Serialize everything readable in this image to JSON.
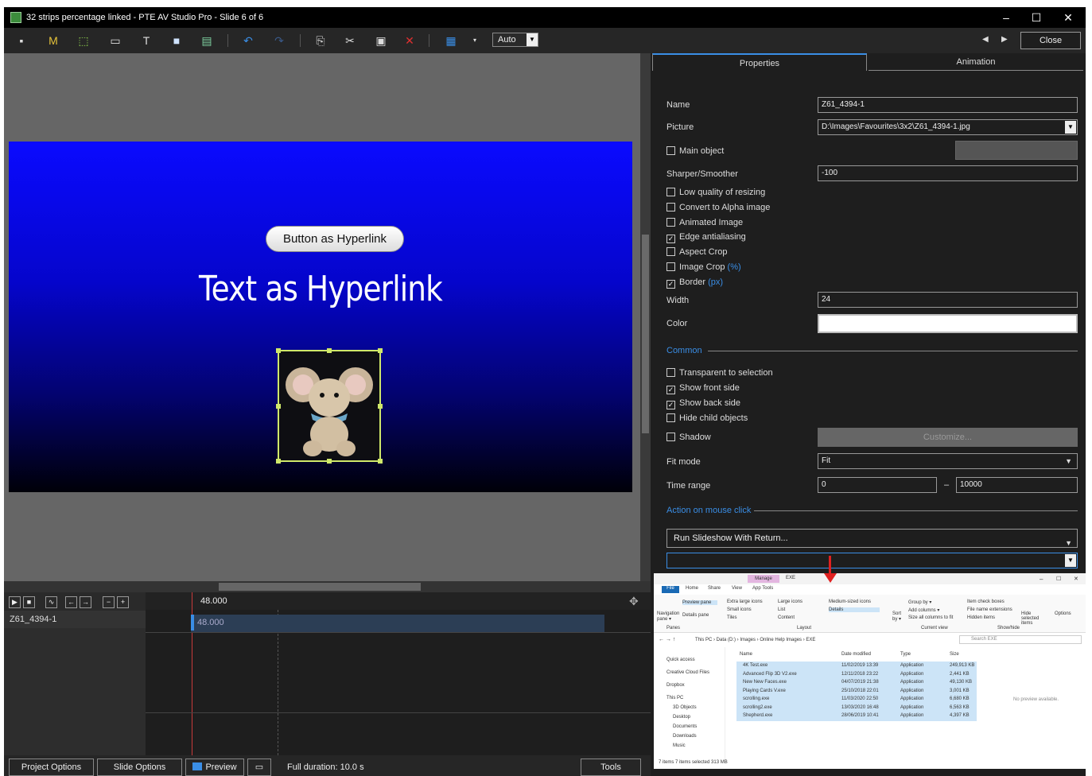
{
  "window": {
    "title": "32 strips percentage linked - PTE AV Studio Pro - Slide 6 of 6"
  },
  "toolbar": {
    "auto_label": "Auto",
    "close_label": "Close",
    "icons": [
      "camera-icon",
      "mask-icon",
      "frame-icon",
      "button-icon",
      "text-icon",
      "rectangle-icon",
      "image-icon",
      "undo-icon",
      "redo-icon",
      "copy-icon",
      "cut-icon",
      "paste-icon",
      "delete-icon",
      "grid-icon"
    ],
    "colors": {
      "delete": "#e03030",
      "undo": "#3a8ee6"
    }
  },
  "preview": {
    "button_text": "Button as Hyperlink",
    "hyperlink_text": "Text as Hyperlink"
  },
  "timeline": {
    "time_marker": "48.000",
    "object_name": "Z61_4394-1",
    "bar_label": "48.000"
  },
  "bottom": {
    "project_options": "Project Options",
    "slide_options": "Slide Options",
    "preview": "Preview",
    "duration": "Full duration: 10.0 s",
    "tools": "Tools"
  },
  "props": {
    "tabs": [
      "Properties",
      "Animation"
    ],
    "name_label": "Name",
    "name_value": "Z61_4394-1",
    "picture_label": "Picture",
    "picture_value": "D:\\Images\\Favourites\\3x2\\Z61_4394-1.jpg",
    "main_object": "Main object",
    "sharper_label": "Sharper/Smoother",
    "sharper_value": "-100",
    "low_quality": "Low quality of resizing",
    "alpha": "Convert to Alpha image",
    "animated": "Animated Image",
    "edge": "Edge antialiasing",
    "aspect": "Aspect Crop",
    "image_crop": "Image Crop",
    "image_crop_unit": "(%)",
    "border": "Border",
    "border_unit": "(px)",
    "width_label": "Width",
    "width_value": "24",
    "color_label": "Color",
    "common": "Common",
    "transparent": "Transparent to selection",
    "front": "Show front side",
    "back": "Show back side",
    "hide_child": "Hide child objects",
    "shadow": "Shadow",
    "customize": "Customize...",
    "fit_label": "Fit mode",
    "fit_value": "Fit",
    "time_label": "Time range",
    "time_from": "0",
    "time_to": "10000",
    "time_dash": "–",
    "action": "Action on mouse click",
    "action_value": "Run Slideshow With Return...",
    "accent": "#3a8ee6"
  },
  "explorer": {
    "manage": "Manage",
    "exe": "EXE",
    "ribbon_tabs": [
      "File",
      "Home",
      "Share",
      "View",
      "App Tools"
    ],
    "path": "This PC  ›  Data (D:)  ›  Images  ›  Online Help Images  ›  EXE",
    "search": "Search EXE",
    "layout_items": [
      "Extra large icons",
      "Large icons",
      "Medium-sized icons",
      "Small icons",
      "List",
      "Details",
      "Tiles",
      "Content"
    ],
    "view_items": [
      "Group by ▾",
      "Add columns ▾",
      "Size all columns to fit",
      "Item check boxes",
      "File name extensions",
      "Hidden items",
      "Hide selected items",
      "Options"
    ],
    "groups": [
      "Panes",
      "Layout",
      "Current view",
      "Show/hide"
    ],
    "pane_items": [
      "Navigation pane ▾",
      "Preview pane",
      "Details pane"
    ],
    "sort": "Sort by ▾",
    "columns": [
      "Name",
      "Date modified",
      "Type",
      "Size"
    ],
    "nav": [
      "Quick access",
      "Creative Cloud Files",
      "Dropbox",
      "This PC",
      "3D Objects",
      "Desktop",
      "Documents",
      "Downloads",
      "Music"
    ],
    "files": [
      [
        "4K Test.exe",
        "11/02/2019 13:39",
        "Application",
        "249,913 KB"
      ],
      [
        "Advanced Flip 3D V2.exe",
        "12/11/2018 23:22",
        "Application",
        "2,441 KB"
      ],
      [
        "New New Faces.exe",
        "04/07/2019 21:38",
        "Application",
        "49,130 KB"
      ],
      [
        "Playing Cards V.exe",
        "25/10/2018 22:01",
        "Application",
        "3,001 KB"
      ],
      [
        "scrolling.exe",
        "11/03/2020 22:50",
        "Application",
        "6,680 KB"
      ],
      [
        "scrolling2.exe",
        "13/03/2020 16:48",
        "Application",
        "6,563 KB"
      ],
      [
        "Shepherd.exe",
        "28/06/2019 10:41",
        "Application",
        "4,397 KB"
      ]
    ],
    "no_preview": "No preview available.",
    "status": "7 items    7 items selected  313 MB"
  }
}
